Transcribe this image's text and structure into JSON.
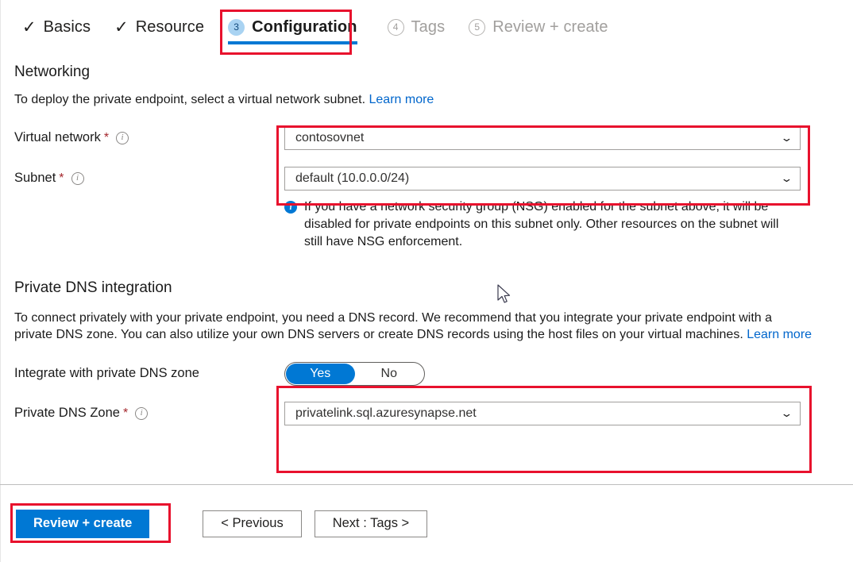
{
  "wizard": {
    "tabs": [
      {
        "label": "Basics",
        "state": "done",
        "marker": "check"
      },
      {
        "label": "Resource",
        "state": "done",
        "marker": "check"
      },
      {
        "label": "Configuration",
        "state": "active",
        "marker": "3"
      },
      {
        "label": "Tags",
        "state": "todo",
        "marker": "4"
      },
      {
        "label": "Review + create",
        "state": "todo",
        "marker": "5"
      }
    ]
  },
  "networking": {
    "title": "Networking",
    "description": "To deploy the private endpoint, select a virtual network subnet.",
    "learn_more": "Learn more",
    "virtual_network": {
      "label": "Virtual network",
      "required_marker": "*",
      "value": "contosovnet"
    },
    "subnet": {
      "label": "Subnet",
      "required_marker": "*",
      "value": "default (10.0.0.0/24)"
    },
    "alert": "If you have a network security group (NSG) enabled for the subnet above, it will be disabled for private endpoints on this subnet only. Other resources on the subnet will still have NSG enforcement."
  },
  "private_dns": {
    "title": "Private DNS integration",
    "description": "To connect privately with your private endpoint, you need a DNS record. We recommend that you integrate your private endpoint with a private DNS zone. You can also utilize your own DNS servers or create DNS records using the host files on your virtual machines.",
    "learn_more": "Learn more",
    "integrate_toggle": {
      "label": "Integrate with private DNS zone",
      "yes": "Yes",
      "no": "No",
      "selected": "Yes"
    },
    "dns_zone": {
      "label": "Private DNS Zone",
      "required_marker": "*",
      "value": "privatelink.sql.azuresynapse.net"
    }
  },
  "footer": {
    "review_create": "Review + create",
    "previous": "< Previous",
    "next": "Next : Tags >"
  },
  "icons": {
    "check": "✓",
    "chevron_down": "⌄",
    "info": "i"
  },
  "colors": {
    "accent_blue": "#0078d4",
    "link_blue": "#0066cc",
    "highlight_red": "#e8112d",
    "required_red": "#a4262c",
    "badge_fill": "#a9d3f2"
  }
}
